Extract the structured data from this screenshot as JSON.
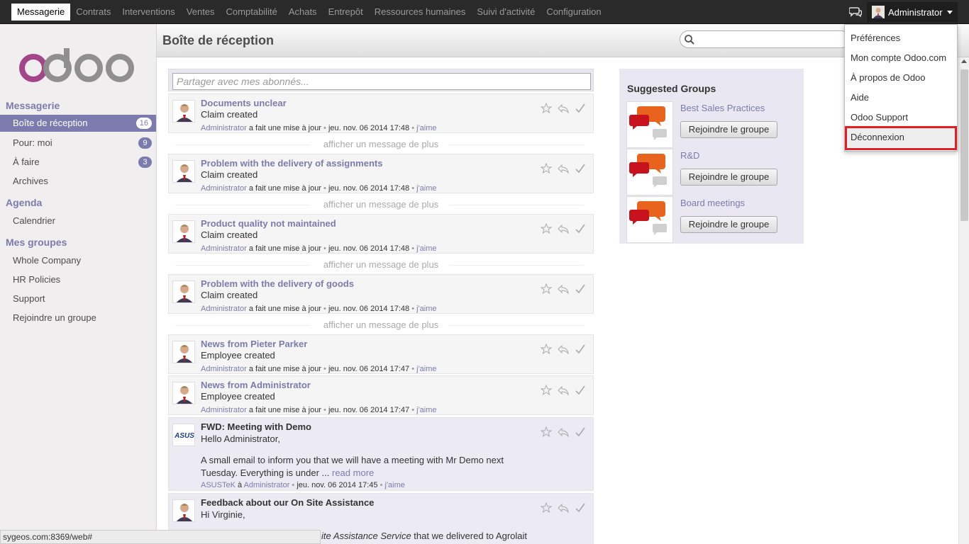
{
  "topbar": {
    "menu": [
      "Messagerie",
      "Contrats",
      "Interventions",
      "Ventes",
      "Comptabilité",
      "Achats",
      "Entrepôt",
      "Ressources humaines",
      "Suivi d'activité",
      "Configuration"
    ],
    "active_menu": "Messagerie",
    "user_name": "Administrator"
  },
  "logo": {
    "text": "odoo"
  },
  "sidebar": {
    "sections": [
      {
        "title": "Messagerie",
        "items": [
          {
            "label": "Boîte de réception",
            "count": "16"
          },
          {
            "label": "Pour: moi",
            "count": "9"
          },
          {
            "label": "À faire",
            "count": "3"
          },
          {
            "label": "Archives",
            "count": ""
          }
        ]
      },
      {
        "title": "Agenda",
        "items": [
          {
            "label": "Calendrier",
            "count": ""
          }
        ]
      },
      {
        "title": "Mes groupes",
        "items": [
          {
            "label": "Whole Company",
            "count": ""
          },
          {
            "label": "HR Policies",
            "count": ""
          },
          {
            "label": "Support",
            "count": ""
          },
          {
            "label": "Rejoindre un groupe",
            "count": ""
          }
        ]
      }
    ]
  },
  "header": {
    "title": "Boîte de réception"
  },
  "compose": {
    "placeholder": "Partager avec mes abonnés..."
  },
  "show_more_label": "afficher un message de plus",
  "messages": [
    {
      "subject": "Documents unclear",
      "body": "Claim created",
      "author": "Administrator",
      "action": "a fait une mise à jour",
      "date": "jeu. nov. 06 2014 17:48",
      "like": "j'aime"
    },
    {
      "subject": "Problem with the delivery of assignments",
      "body": "Claim created",
      "author": "Administrator",
      "action": "a fait une mise à jour",
      "date": "jeu. nov. 06 2014 17:48",
      "like": "j'aime"
    },
    {
      "subject": "Product quality not maintained",
      "body": "Claim created",
      "author": "Administrator",
      "action": "a fait une mise à jour",
      "date": "jeu. nov. 06 2014 17:48",
      "like": "j'aime"
    },
    {
      "subject": "Problem with the delivery of goods",
      "body": "Claim created",
      "author": "Administrator",
      "action": "a fait une mise à jour",
      "date": "jeu. nov. 06 2014 17:48",
      "like": "j'aime"
    },
    {
      "subject": "News from Pieter Parker",
      "body": "Employee created",
      "author": "Administrator",
      "action": "a fait une mise à jour",
      "date": "jeu. nov. 06 2014 17:47",
      "like": "j'aime"
    },
    {
      "subject": "News from Administrator",
      "body": "Employee created",
      "author": "Administrator",
      "action": "a fait une mise à jour",
      "date": "jeu. nov. 06 2014 17:47",
      "like": "j'aime"
    }
  ],
  "email_message": {
    "subject": "FWD: Meeting with Demo",
    "greeting": "Hello Administrator,",
    "text1": "A small email to inform you that we will have a meeting with Mr Demo next",
    "text2": "Tuesday. Everything is under ...",
    "read_more": "read more",
    "author": "ASUSTeK",
    "to": "à",
    "recipient": "Administrator",
    "date": "jeu. nov. 06 2014 17:45",
    "like": "j'aime",
    "logo_text": "ASUS"
  },
  "feedback_message": {
    "subject": "Feedback about our On Site Assistance",
    "greeting": "Hi Virginie,",
    "text_italic": "ite Assistance Service",
    "text_rest": " that we delivered to Agrolait"
  },
  "groups": {
    "title": "Suggested Groups",
    "join_label": "Rejoindre le groupe",
    "items": [
      "Best Sales Practices",
      "R&D",
      "Board meetings"
    ]
  },
  "user_menu": {
    "items": [
      "Préférences",
      "Mon compte Odoo.com",
      "À propos de Odoo",
      "Aide",
      "Odoo Support",
      "Déconnexion"
    ]
  },
  "statusbar": {
    "url": "sygeos.com:8369/web#"
  },
  "colors": {
    "accent": "#7c7bad",
    "topbar": "#2a2a2a",
    "highlight": "#e31e24",
    "logo_pink": "#a24689",
    "logo_grey": "#8f8f8f"
  }
}
